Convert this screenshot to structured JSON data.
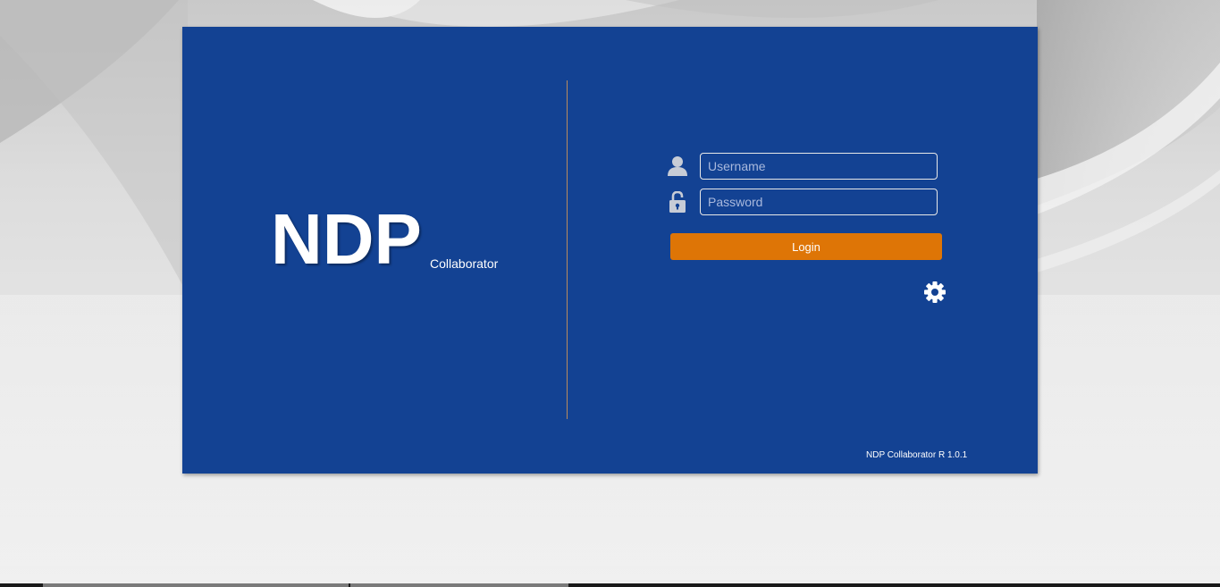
{
  "brand": {
    "name": "NDP",
    "subtitle": "Collaborator"
  },
  "login_form": {
    "username": {
      "icon": "user-icon",
      "placeholder": "Username",
      "value": ""
    },
    "password": {
      "icon": "lock-icon",
      "placeholder": "Password",
      "value": ""
    },
    "login_label": "Login",
    "settings_icon": "gear-icon"
  },
  "footer": {
    "version": "NDP Collaborator R 1.0.1"
  },
  "colors": {
    "panel": "#134293",
    "accent": "#de7506",
    "divider": "#b98b5e",
    "text": "#ffffff"
  }
}
